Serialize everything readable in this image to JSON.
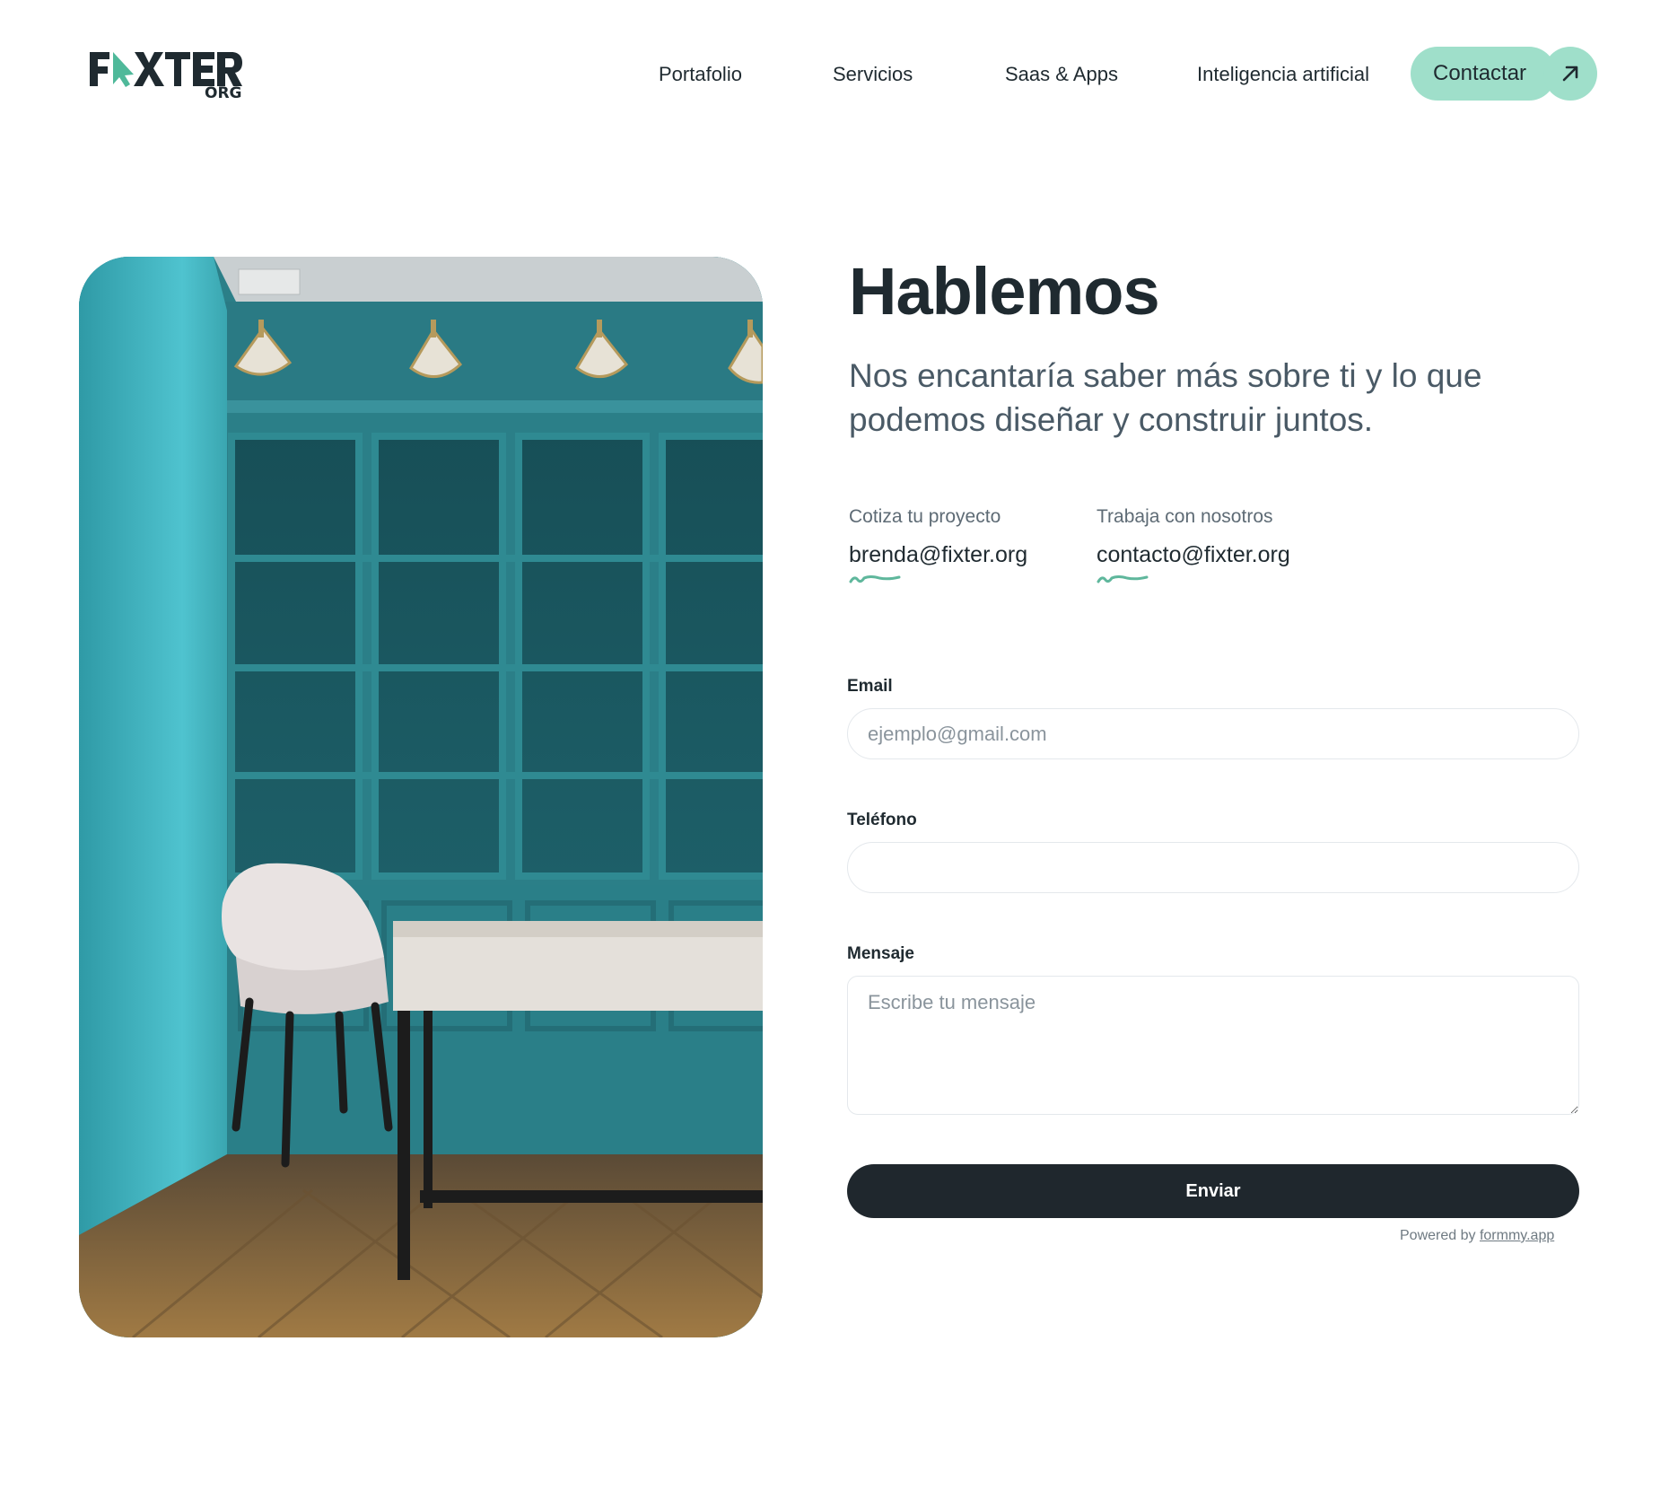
{
  "brand": {
    "logo_main": "F XTER",
    "logo_sub": "ORG",
    "accent": "#9fdfca",
    "dark": "#1f272d"
  },
  "nav": {
    "links": [
      {
        "label": "Portafolio"
      },
      {
        "label": "Servicios"
      },
      {
        "label": "Saas & Apps"
      },
      {
        "label": "Inteligencia artificial"
      }
    ],
    "cta_label": "Contactar",
    "cta_icon": "arrow-up-right-icon"
  },
  "hero": {
    "title": "Hablemos",
    "subtitle": "Nos encantaría saber más sobre ti y lo que podemos diseñar y construir juntos."
  },
  "contacts": [
    {
      "label": "Cotiza tu proyecto",
      "email": "brenda@fixter.org"
    },
    {
      "label": "Trabaja con nosotros",
      "email": "contacto@fixter.org"
    }
  ],
  "form": {
    "email_label": "Email",
    "email_placeholder": "ejemplo@gmail.com",
    "email_value": "",
    "phone_label": "Teléfono",
    "phone_placeholder": "",
    "phone_value": "",
    "message_label": "Mensaje",
    "message_placeholder": "Escribe tu mensaje",
    "message_value": "",
    "submit_label": "Enviar",
    "powered_prefix": "Powered by",
    "powered_link": "formmy.app"
  }
}
